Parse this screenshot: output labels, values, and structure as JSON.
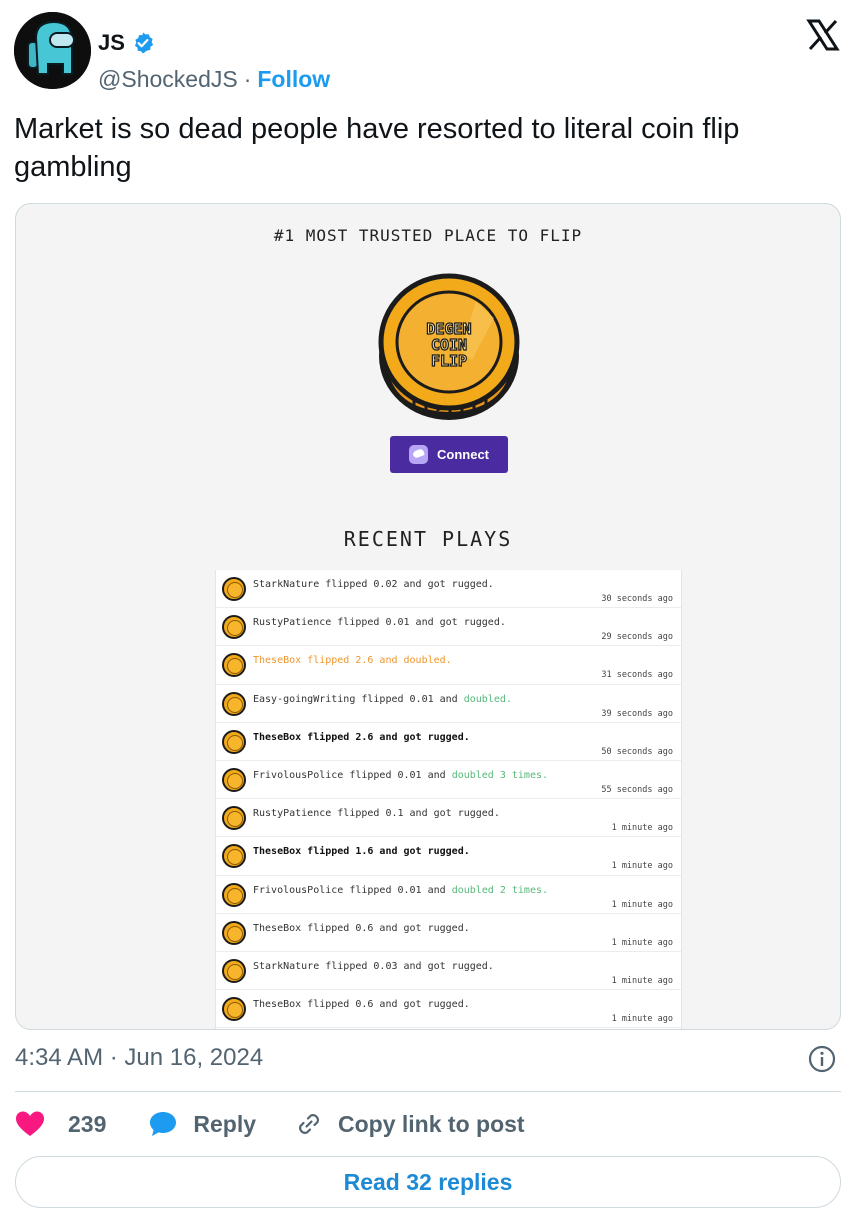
{
  "author": {
    "display_name": "JS",
    "handle": "@ShockedJS",
    "separator": "·",
    "follow_label": "Follow"
  },
  "tweet": {
    "text": "Market is so dead people have resorted to literal coin flip gambling",
    "timestamp": "4:34 AM · Jun 16, 2024"
  },
  "media": {
    "tagline": "#1 MOST TRUSTED PLACE TO FLIP",
    "coin_text": [
      "DEGEN",
      "COIN",
      "FLIP"
    ],
    "connect_label": "Connect",
    "recent_title": "RECENT PLAYS",
    "plays": [
      {
        "text": "StarkNature flipped 0.02 and got rugged.",
        "time": "30 seconds ago",
        "style": "normal"
      },
      {
        "text": "RustyPatience flipped 0.01 and got rugged.",
        "time": "29 seconds ago",
        "style": "normal"
      },
      {
        "text": "TheseBox flipped 2.6 and doubled.",
        "time": "31 seconds ago",
        "style": "orange"
      },
      {
        "text": "Easy-goingWriting flipped 0.01 and ",
        "highlight": "doubled.",
        "time": "39 seconds ago",
        "style": "normal"
      },
      {
        "text": "TheseBox flipped 2.6 and got rugged.",
        "time": "50 seconds ago",
        "style": "bold"
      },
      {
        "text": "FrivolousPolice flipped 0.01 and ",
        "highlight": "doubled 3 times.",
        "time": "55 seconds ago",
        "style": "normal"
      },
      {
        "text": "RustyPatience flipped 0.1 and got rugged.",
        "time": "1 minute ago",
        "style": "normal"
      },
      {
        "text": "TheseBox flipped 1.6 and got rugged.",
        "time": "1 minute ago",
        "style": "bold"
      },
      {
        "text": "FrivolousPolice flipped 0.01 and ",
        "highlight": "doubled 2 times.",
        "time": "1 minute ago",
        "style": "normal"
      },
      {
        "text": "TheseBox flipped 0.6 and got rugged.",
        "time": "1 minute ago",
        "style": "normal"
      },
      {
        "text": "StarkNature flipped 0.03 and got rugged.",
        "time": "1 minute ago",
        "style": "normal"
      },
      {
        "text": "TheseBox flipped 0.6 and got rugged.",
        "time": "1 minute ago",
        "style": "normal"
      }
    ]
  },
  "engagement": {
    "like_count": "239",
    "reply_label": "Reply",
    "copy_label": "Copy link to post",
    "read_replies_label": "Read 32 replies"
  },
  "colors": {
    "accent": "#1d9bf0",
    "like": "#f91880",
    "connect_button": "#4a2ca0",
    "coin_gold": "#f2a91a",
    "doubled_green": "#57b97a",
    "doubled_orange": "#f0962c"
  },
  "icons": {
    "verified": "verified-badge-icon",
    "brand": "x-logo-icon",
    "info": "info-icon",
    "like": "heart-icon",
    "reply": "speech-bubble-icon",
    "copy": "link-icon"
  }
}
